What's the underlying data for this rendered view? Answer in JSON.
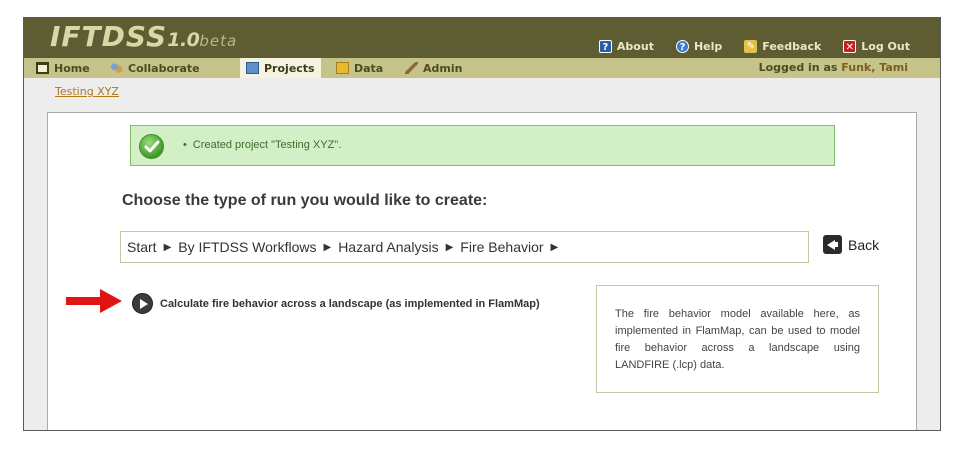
{
  "app": {
    "logo_main": "IFTDSS",
    "logo_version": "1.0",
    "logo_beta": "beta"
  },
  "toplinks": [
    {
      "label": "About",
      "icon": "about-icon"
    },
    {
      "label": "Help",
      "icon": "help-icon"
    },
    {
      "label": "Feedback",
      "icon": "feedback-icon"
    },
    {
      "label": "Log Out",
      "icon": "logout-icon"
    }
  ],
  "nav": {
    "items": [
      {
        "label": "Home",
        "icon": "home-icon"
      },
      {
        "label": "Collaborate",
        "icon": "collaborate-icon"
      },
      {
        "label": "Projects",
        "icon": "projects-icon",
        "active": true
      },
      {
        "label": "Data",
        "icon": "data-icon"
      },
      {
        "label": "Admin",
        "icon": "admin-icon"
      }
    ],
    "logged_in_prefix": "Logged in as",
    "user_name": "Funk, Tami"
  },
  "breadcrumb": {
    "project": "Testing XYZ"
  },
  "message": {
    "text": "Created project \"Testing XYZ\"."
  },
  "main": {
    "heading": "Choose the type of run you would like to create:",
    "path": [
      "Start",
      "By IFTDSS Workflows",
      "Hazard Analysis",
      "Fire Behavior"
    ],
    "back_label": "Back",
    "option_label": "Calculate fire behavior across a landscape (as implemented in FlamMap)",
    "description": "The fire behavior model available here, as implemented in FlamMap, can be used to model fire behavior across a landscape using LANDFIRE (.lcp) data."
  },
  "colors": {
    "header_bg": "#5d5c33",
    "navbar_bg": "#c5c28a",
    "success_bg": "#d3efc6",
    "arrow": "#e01414"
  }
}
